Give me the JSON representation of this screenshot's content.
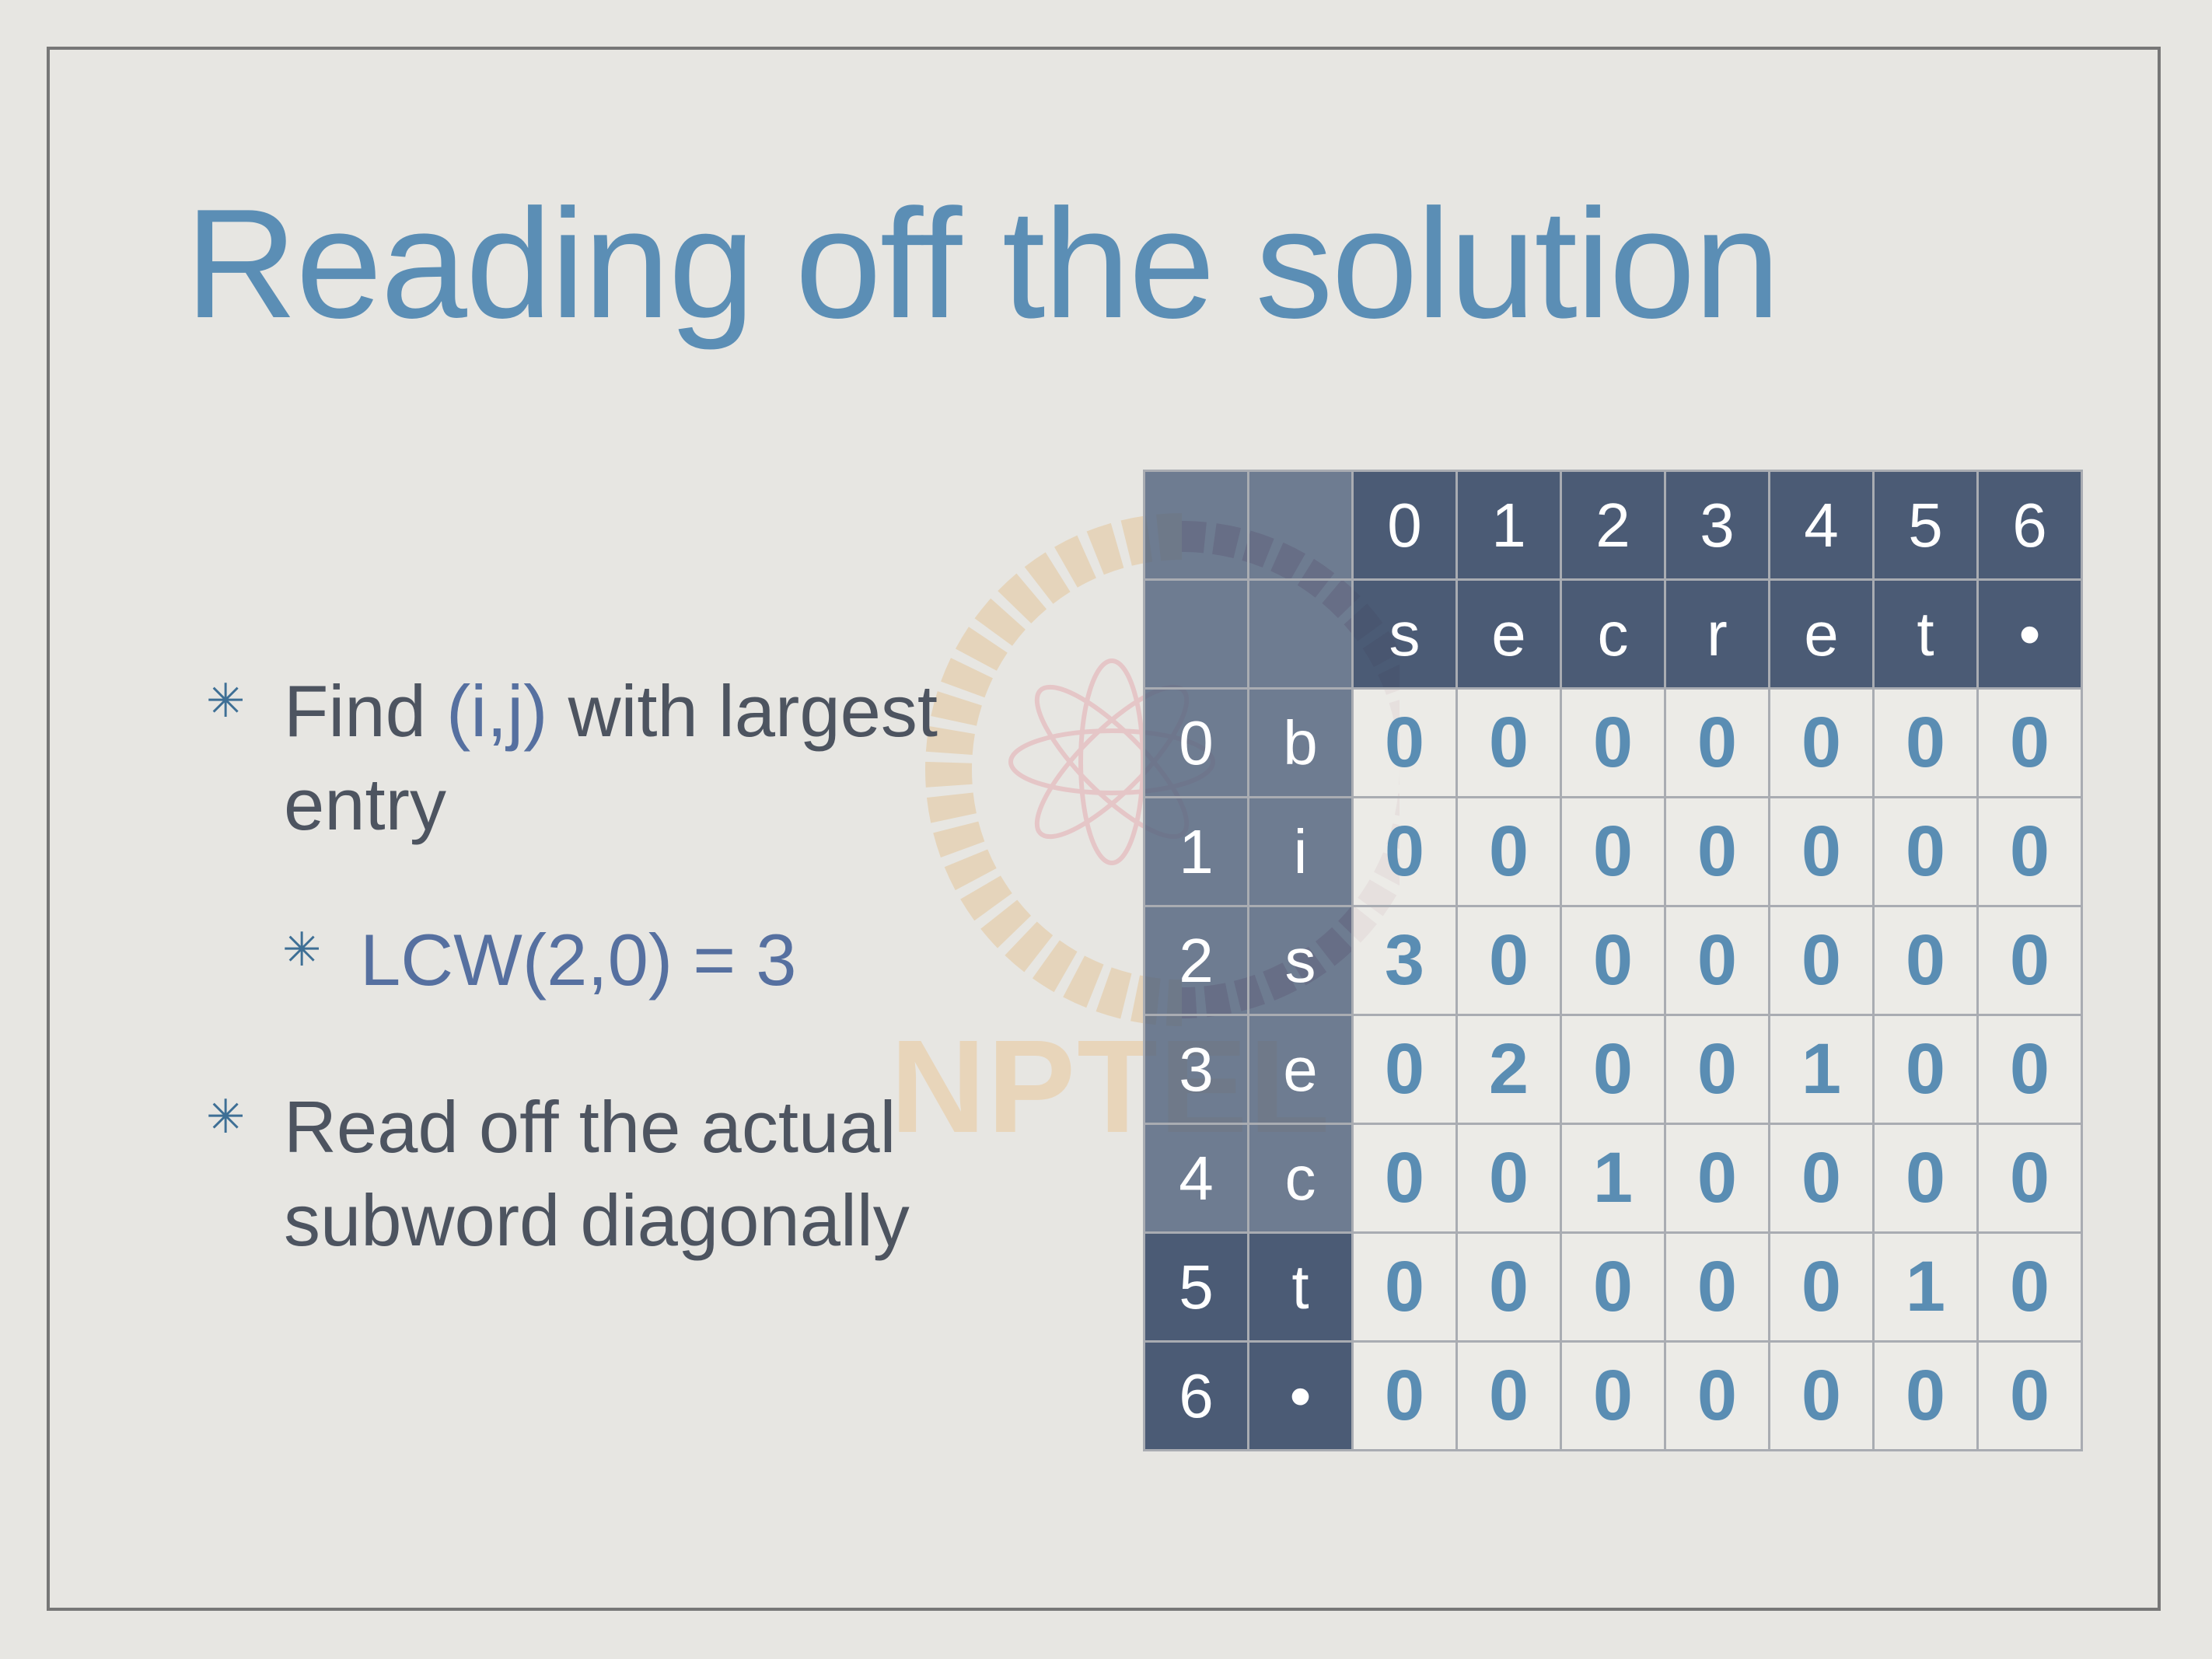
{
  "slide": {
    "title": "Reading off the solution",
    "watermark": "NPTEL",
    "bullets": [
      {
        "parts": [
          "Find ",
          "(i,j)",
          " with largest entry"
        ]
      },
      {
        "sub": "LCW(2,0) = 3"
      },
      {
        "text": "Read off the actual subword diagonally"
      }
    ],
    "table": {
      "col_indices": [
        "0",
        "1",
        "2",
        "3",
        "4",
        "5",
        "6"
      ],
      "col_chars": [
        "s",
        "e",
        "c",
        "r",
        "e",
        "t",
        "•"
      ],
      "row_indices": [
        "0",
        "1",
        "2",
        "3",
        "4",
        "5",
        "6"
      ],
      "row_chars": [
        "b",
        "i",
        "s",
        "e",
        "c",
        "t",
        "•"
      ],
      "values": [
        [
          "0",
          "0",
          "0",
          "0",
          "0",
          "0",
          "0"
        ],
        [
          "0",
          "0",
          "0",
          "0",
          "0",
          "0",
          "0"
        ],
        [
          "3",
          "0",
          "0",
          "0",
          "0",
          "0",
          "0"
        ],
        [
          "0",
          "2",
          "0",
          "0",
          "1",
          "0",
          "0"
        ],
        [
          "0",
          "0",
          "1",
          "0",
          "0",
          "0",
          "0"
        ],
        [
          "0",
          "0",
          "0",
          "0",
          "0",
          "1",
          "0"
        ],
        [
          "0",
          "0",
          "0",
          "0",
          "0",
          "0",
          "0"
        ]
      ]
    },
    "colors": {
      "title": "#5b8eb5",
      "header": "#3e4f6b",
      "value": "#5a8db3",
      "text": "#4d5460"
    }
  }
}
